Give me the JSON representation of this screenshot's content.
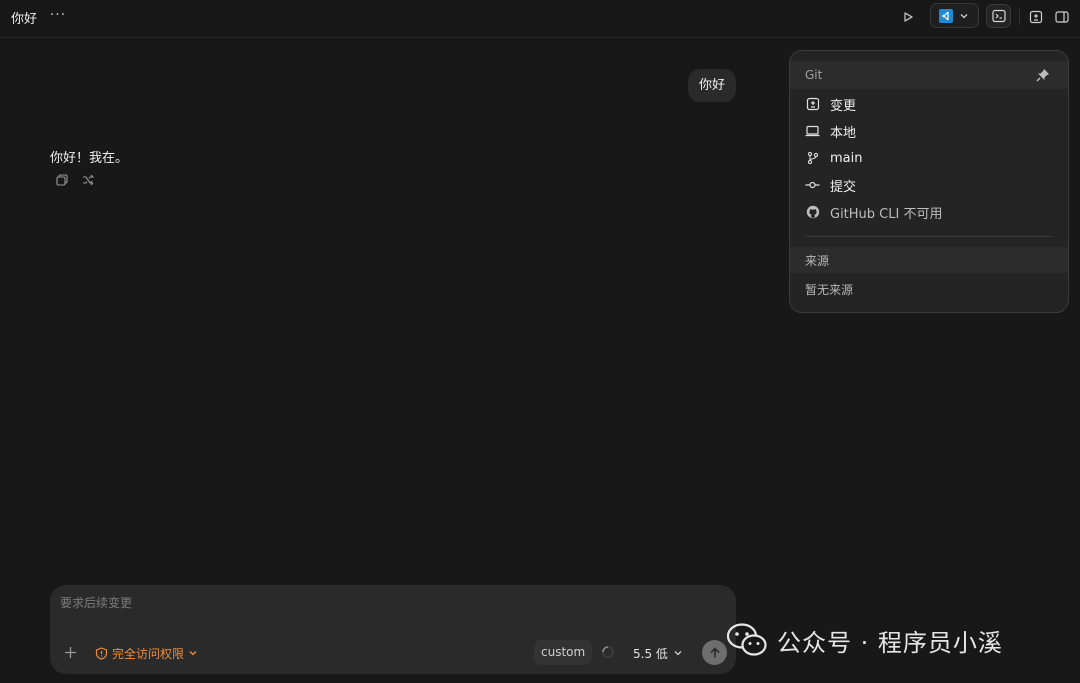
{
  "header": {
    "title": "你好",
    "more_label": "···"
  },
  "chat": {
    "user_message": "你好",
    "assistant_message": "你好！我在。"
  },
  "git_panel": {
    "header": "Git",
    "items": [
      {
        "label": "变更",
        "icon": "diff-icon"
      },
      {
        "label": "本地",
        "icon": "laptop-icon"
      },
      {
        "label": "main",
        "icon": "branch-icon"
      },
      {
        "label": "提交",
        "icon": "commit-icon"
      },
      {
        "label": "GitHub CLI 不可用",
        "icon": "github-icon"
      }
    ],
    "source_header": "来源",
    "no_source": "暂无来源"
  },
  "composer": {
    "placeholder": "要求后续变更",
    "access_label": "完全访问权限",
    "custom_label": "custom",
    "model_label": "5.5 低"
  },
  "watermark": {
    "text": "公众号 · 程序员小溪"
  },
  "colors": {
    "background": "#181818",
    "accent_orange": "#ef8c3d",
    "vscode_blue": "#1f8ad2",
    "wechat_green": "#e6e6e6"
  }
}
